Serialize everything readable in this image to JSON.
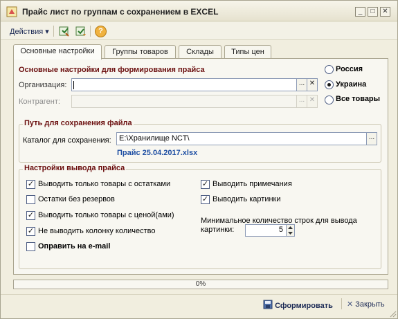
{
  "window": {
    "title": "Прайс лист по группам с сохранением в EXCEL",
    "minimize_symbol": "_",
    "maximize_symbol": "□",
    "close_symbol": "✕"
  },
  "toolbar": {
    "actions_label": "Действия",
    "actions_arrow": "▾",
    "help_symbol": "?"
  },
  "tabs": [
    {
      "label": "Основные настройки",
      "active": true
    },
    {
      "label": "Группы товаров",
      "active": false
    },
    {
      "label": "Склады",
      "active": false
    },
    {
      "label": "Типы цен",
      "active": false
    }
  ],
  "main": {
    "section_title": "Основные настройки для формирования прайса",
    "organization_label": "Организация:",
    "organization_value": "",
    "contractor_label": "Контрагент:",
    "contractor_value": "",
    "ellipsis": "...",
    "clear_symbol": "✕"
  },
  "regions": [
    {
      "label": "Россия",
      "selected": false
    },
    {
      "label": "Украина",
      "selected": true
    },
    {
      "label": "Все товары",
      "selected": false
    }
  ],
  "save_path": {
    "group_title": "Путь для сохранения файла",
    "catalog_label": "Каталог для сохранения:",
    "catalog_value": "E:\\Хранилище NCT\\",
    "filename": "Прайс 25.04.2017.xlsx"
  },
  "output_settings": {
    "group_title": "Настройки вывода прайса",
    "left": [
      {
        "label": "Выводить только товары с остатками",
        "checked": true,
        "bold": false
      },
      {
        "label": "Остатки без резервов",
        "checked": false,
        "bold": false
      },
      {
        "label": "Выводить только товары с ценой(ами)",
        "checked": true,
        "bold": false
      },
      {
        "label": "Не выводить колонку количество",
        "checked": true,
        "bold": false
      },
      {
        "label": "Оправить на e-mail",
        "checked": false,
        "bold": true
      }
    ],
    "right": [
      {
        "label": "Выводить примечания",
        "checked": true
      },
      {
        "label": "Выводить картинки",
        "checked": true
      }
    ],
    "min_rows_label_line1": "Минимальное количество строк для вывода",
    "min_rows_label_line2": "картинки:",
    "min_rows_value": "5",
    "check_mark": "✓"
  },
  "progress": {
    "text": "0%",
    "value": 0
  },
  "footer": {
    "generate_label": "Сформировать",
    "close_label": "Закрыть"
  },
  "colors": {
    "section_title": "#6b0f0f",
    "link": "#1f4fa3",
    "accent": "#e8a33a"
  }
}
